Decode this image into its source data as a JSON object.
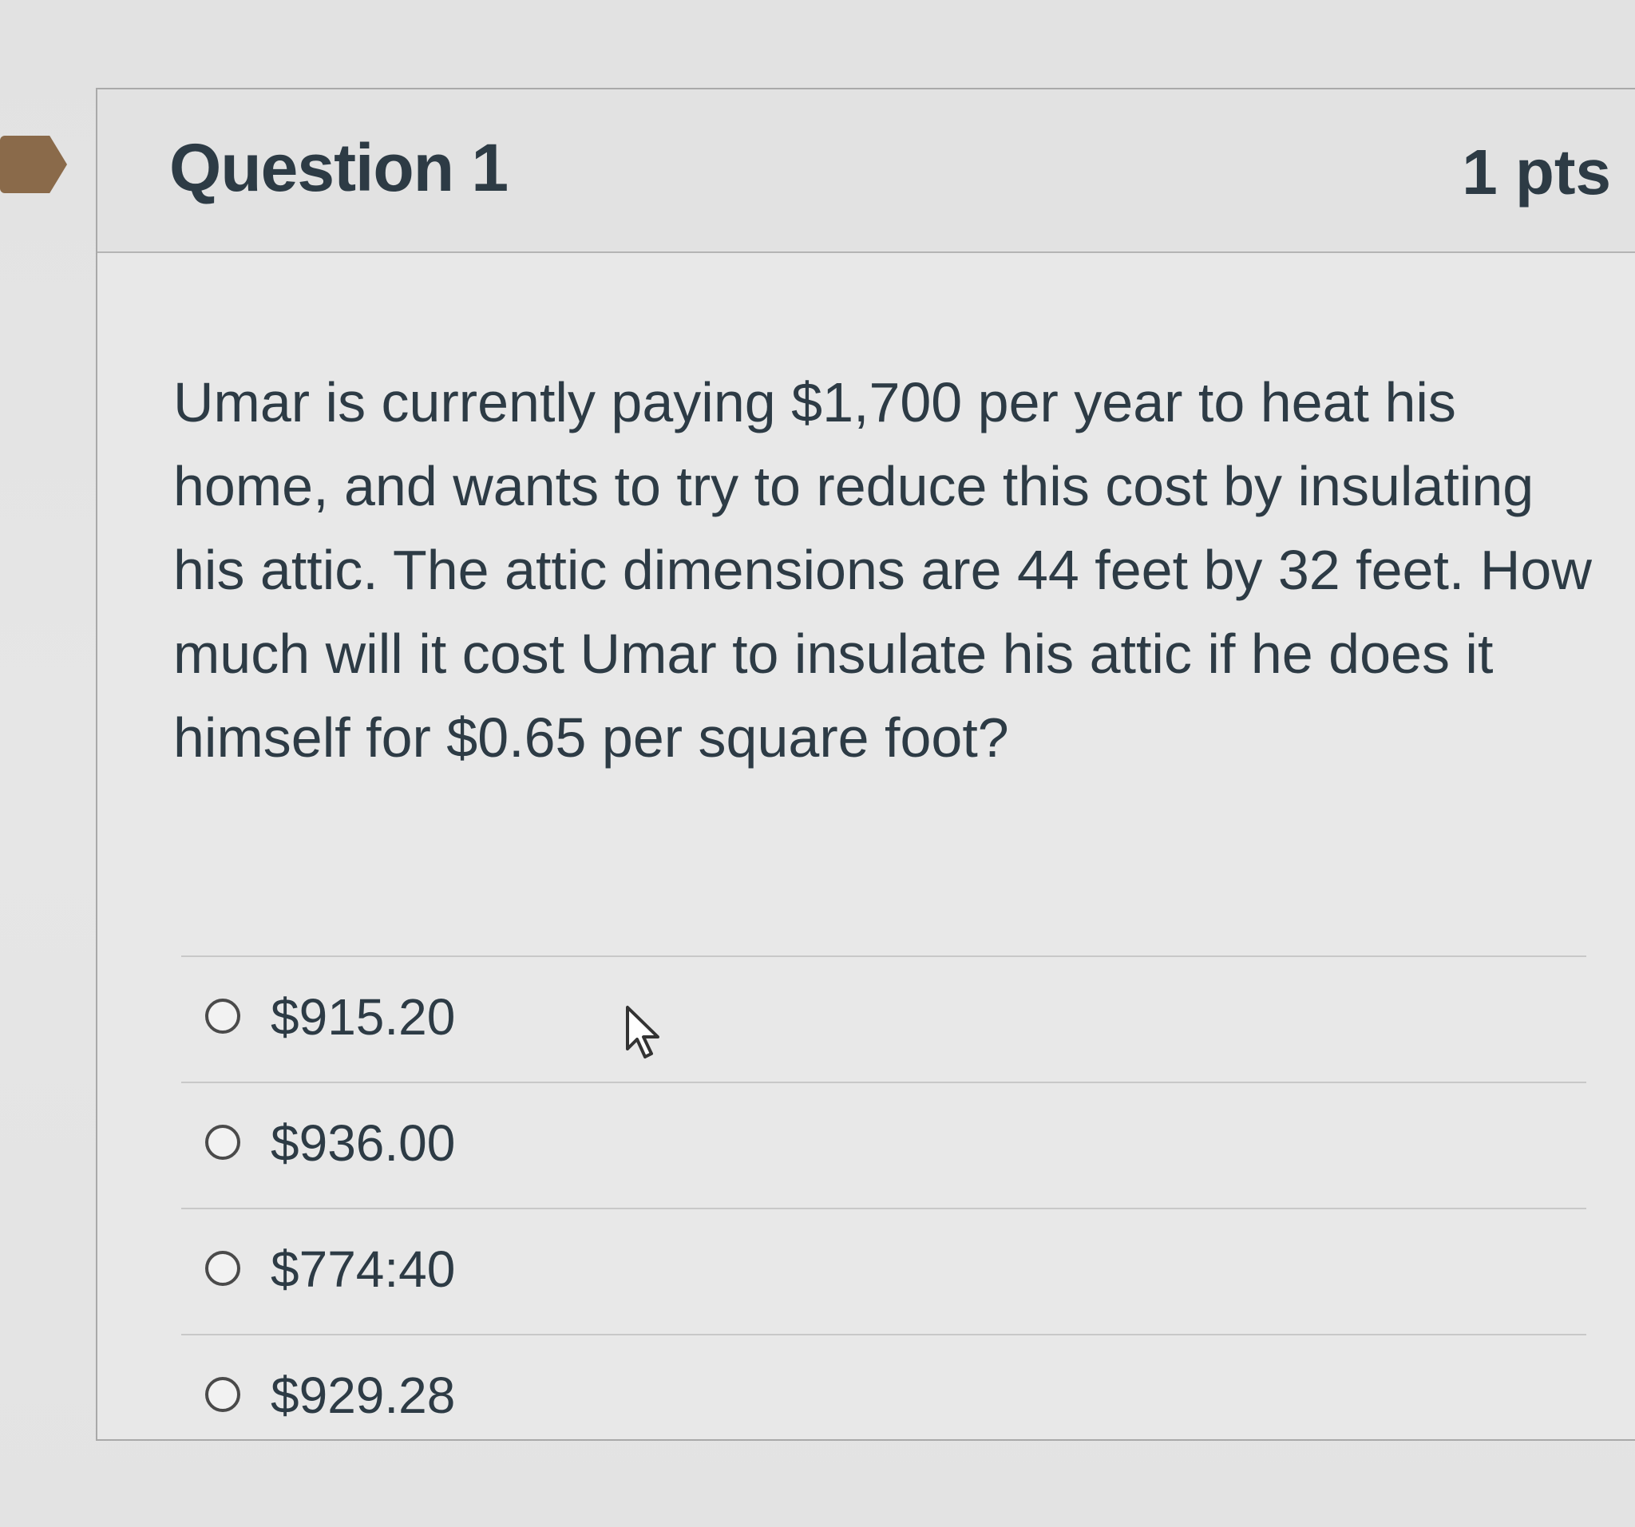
{
  "question": {
    "title": "Question 1",
    "points": "1 pts",
    "text": "Umar is currently paying $1,700 per year to heat his home, and wants to try to reduce this cost by insulating his attic. The attic dimensions are 44 feet by 32 feet. How much will it cost Umar to insulate his attic if he does it himself for $0.65 per square foot?"
  },
  "answers": [
    {
      "label": "$915.20"
    },
    {
      "label": "$936.00"
    },
    {
      "label": "$774:40"
    },
    {
      "label": "$929.28"
    }
  ],
  "icons": {
    "bookmark": "bookmark-flag-icon",
    "radio": "radio-button-icon",
    "cursor": "mouse-pointer-icon"
  },
  "colors": {
    "text": "#2d3b45",
    "bookmark": "#8a6a4a"
  }
}
